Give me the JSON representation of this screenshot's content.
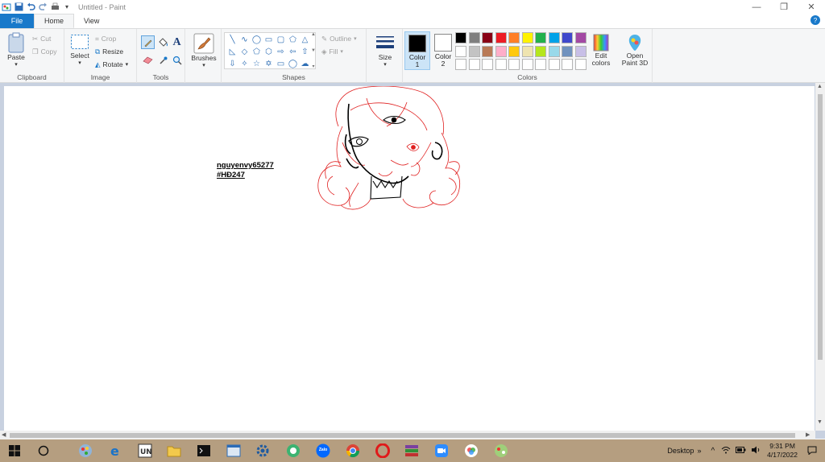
{
  "window": {
    "title": "Untitled - Paint",
    "quick_access": [
      "paint-app-icon",
      "save-icon",
      "undo-icon",
      "redo-icon",
      "print-icon",
      "customize-dropdown-icon"
    ]
  },
  "tabs": [
    "File",
    "Home",
    "View"
  ],
  "ribbon": {
    "clipboard": {
      "paste": "Paste",
      "cut": "Cut",
      "copy": "Copy",
      "label": "Clipboard"
    },
    "image": {
      "select": "Select",
      "crop": "Crop",
      "resize": "Resize",
      "rotate": "Rotate",
      "label": "Image"
    },
    "tools": {
      "label": "Tools"
    },
    "brushes": {
      "label": "Brushes"
    },
    "shapes": {
      "outline": "Outline",
      "fill": "Fill",
      "label": "Shapes"
    },
    "size": {
      "label": "Size"
    },
    "colors": {
      "color1": "Color",
      "color1_num": "1",
      "color2": "Color",
      "color2_num": "2",
      "edit_colors_1": "Edit",
      "edit_colors_2": "colors",
      "label": "Colors",
      "color1_value": "#000000",
      "color2_value": "#ffffff",
      "palette": [
        "#000000",
        "#7f7f7f",
        "#880015",
        "#ed1c24",
        "#ff7f27",
        "#fff200",
        "#22b14c",
        "#00a2e8",
        "#3f48cc",
        "#a349a4",
        "#ffffff",
        "#c3c3c3",
        "#b97a57",
        "#ffaec9",
        "#ffc90e",
        "#efe4b0",
        "#b5e61d",
        "#99d9ea",
        "#7092be",
        "#c8bfe7",
        "#ffffff",
        "#ffffff",
        "#ffffff",
        "#ffffff",
        "#ffffff",
        "#ffffff",
        "#ffffff",
        "#ffffff",
        "#ffffff",
        "#ffffff"
      ]
    },
    "paint3d": {
      "line1": "Open",
      "line2": "Paint 3D"
    }
  },
  "canvas": {
    "text_line1": "nguyenvy65277",
    "text_line2": "#HĐ247"
  },
  "taskbar": {
    "desktop_label": "Desktop",
    "time": "9:31 PM",
    "date": "4/17/2022",
    "zalo_label": "Zalo"
  }
}
